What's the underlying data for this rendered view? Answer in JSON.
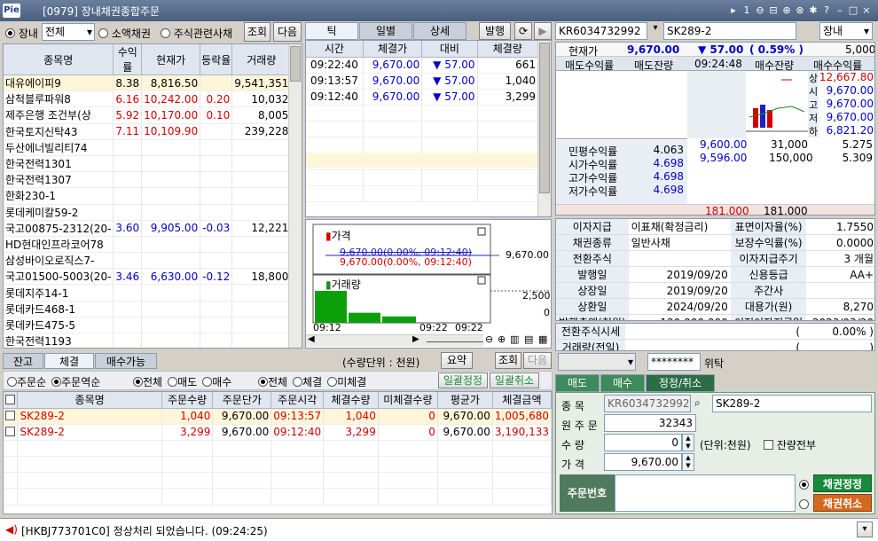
{
  "window": {
    "title": "[0979] 장내채권종합주문",
    "logo": "Pie",
    "controls": [
      "▸",
      "1",
      "⊖",
      "⊟",
      "⊕",
      "⊗",
      "✱",
      "?",
      "–",
      "□",
      "×"
    ]
  },
  "left": {
    "market_options": [
      {
        "label": "장내",
        "on": true
      },
      {
        "label": "소액채권",
        "on": false
      },
      {
        "label": "주식관련사채",
        "on": false
      }
    ],
    "filter_value": "전체",
    "btn_query": "조회",
    "btn_next": "다음",
    "headers": [
      "종목명",
      "수익률",
      "현재가",
      "등락율",
      "거래량"
    ],
    "rows": [
      {
        "name": "대유에이피9",
        "yield": "8.38",
        "price": "8,816.50",
        "chg": "",
        "vol": "9,541,351",
        "sel": true
      },
      {
        "name": "삼척블루파워8",
        "yield": "6.16",
        "price": "10,242.00",
        "chg": "0.20",
        "vol": "10,032",
        "color": "red"
      },
      {
        "name": "제주은행 조건부(상",
        "yield": "5.92",
        "price": "10,170.00",
        "chg": "0.10",
        "vol": "8,005",
        "color": "red"
      },
      {
        "name": "한국토지신탁43",
        "yield": "7.11",
        "price": "10,109.90",
        "chg": "",
        "vol": "239,228",
        "color": "red"
      },
      {
        "name": "두산에너빌리티74",
        "yield": "",
        "price": "",
        "chg": "",
        "vol": ""
      },
      {
        "name": "한국전력1301",
        "yield": "",
        "price": "",
        "chg": "",
        "vol": ""
      },
      {
        "name": "한국전력1307",
        "yield": "",
        "price": "",
        "chg": "",
        "vol": ""
      },
      {
        "name": "한화230-1",
        "yield": "",
        "price": "",
        "chg": "",
        "vol": ""
      },
      {
        "name": "롯데케미칼59-2",
        "yield": "",
        "price": "",
        "chg": "",
        "vol": ""
      },
      {
        "name": "국고00875-2312(20-",
        "yield": "3.60",
        "price": "9,905.00",
        "chg": "-0.03",
        "vol": "12,221",
        "color": "blue"
      },
      {
        "name": "HD현대인프라코어78",
        "yield": "",
        "price": "",
        "chg": "",
        "vol": ""
      },
      {
        "name": "삼성바이오로직스7-",
        "yield": "",
        "price": "",
        "chg": "",
        "vol": ""
      },
      {
        "name": "국고01500-5003(20-",
        "yield": "3.46",
        "price": "6,630.00",
        "chg": "-0.12",
        "vol": "18,800",
        "color": "blue"
      },
      {
        "name": "롯데지주14-1",
        "yield": "",
        "price": "",
        "chg": "",
        "vol": ""
      },
      {
        "name": "롯데카드468-1",
        "yield": "",
        "price": "",
        "chg": "",
        "vol": ""
      },
      {
        "name": "롯데카드475-5",
        "yield": "",
        "price": "",
        "chg": "",
        "vol": ""
      },
      {
        "name": "한국전력1193",
        "yield": "",
        "price": "",
        "chg": "",
        "vol": ""
      },
      {
        "name": "한국전력1269",
        "yield": "",
        "price": "",
        "chg": "",
        "vol": ""
      }
    ]
  },
  "tick": {
    "tabs": [
      "틱",
      "일별",
      "상세"
    ],
    "btn_issue": "발행",
    "headers": [
      "시간",
      "체결가",
      "대비",
      "체결량"
    ],
    "rows": [
      {
        "time": "09:22:40",
        "price": "9,670.00",
        "diff": "▼ 57.00",
        "qty": "661"
      },
      {
        "time": "09:13:57",
        "price": "9,670.00",
        "diff": "▼ 57.00",
        "qty": "1,040"
      },
      {
        "time": "09:12:40",
        "price": "9,670.00",
        "diff": "▼ 57.00",
        "qty": "3,299"
      }
    ]
  },
  "chart": {
    "label_price": "가격",
    "label_vol": "거래량",
    "legend1": "9,670.00(0.00%, 09:12:40)",
    "legend2": "9,670.00(0.00%, 09:12:40)",
    "price_tick": "9,670.00",
    "vol_ticks": [
      "2,500",
      "0"
    ],
    "x_ticks": [
      "09:12",
      "09:22",
      "09:22"
    ]
  },
  "chart_data": {
    "type": "bar",
    "categories": [
      "09:12",
      "09:13",
      "09:22"
    ],
    "values": [
      3299,
      1040,
      661
    ],
    "ylim": [
      0,
      5000
    ],
    "price_line": 9670
  },
  "quote": {
    "code": "KR6034732992",
    "name": "SK289-2",
    "market": "장내",
    "cur_label": "현재가",
    "cur_price": "9,670.00",
    "cur_diff": "▼ 57.00",
    "cur_pct": "( 0.59% )",
    "cur_vol": "5,000",
    "headers": [
      "매도수익률",
      "매도잔량",
      "09:24:48",
      "매수잔량",
      "매수수익률"
    ],
    "side_labels": [
      "상",
      "시",
      "고",
      "저",
      "하"
    ],
    "side_values": [
      "12,667.80",
      "9,670.00",
      "9,670.00",
      "9,670.00",
      "6,821.20"
    ],
    "bids": [
      {
        "price": "9,600.00",
        "qty": "31,000",
        "yield": "5.275"
      },
      {
        "price": "9,596.00",
        "qty": "150,000",
        "yield": "5.309"
      }
    ],
    "yields": [
      {
        "label": "민평수익률",
        "value": "4.063"
      },
      {
        "label": "시가수익률",
        "value": "4.698"
      },
      {
        "label": "고가수익률",
        "value": "4.698"
      },
      {
        "label": "저가수익률",
        "value": "4.698"
      }
    ],
    "total_ask": "181,000",
    "total_bid": "181,000"
  },
  "info": [
    [
      "이자지급",
      "이표채(확정금리)",
      "표면이자율(%)",
      "1.7550"
    ],
    [
      "채권종류",
      "일반사채",
      "보장수익률(%)",
      "0.0000"
    ],
    [
      "전환주식",
      "",
      "이자지급주기",
      "3 개월"
    ],
    [
      "발행일",
      "2019/09/20",
      "신용등급",
      "AA+"
    ],
    [
      "상장일",
      "2019/09/20",
      "주간사",
      ""
    ],
    [
      "상환일",
      "2024/09/20",
      "대용가(원)",
      "8,270"
    ],
    [
      "발행총액(천원)",
      "120,000,000",
      "이전이자지급일",
      "2023/03/20"
    ]
  ],
  "conv": [
    {
      "label": "전환주식시세",
      "v1": "(",
      "v2": "0.00% )"
    },
    {
      "label": "거래량(전일)",
      "v1": "(",
      "v2": ")"
    }
  ],
  "bottom": {
    "tabs": [
      "잔고",
      "체결",
      "매수가능"
    ],
    "unit": "(수량단위 : 천원)",
    "btn_sum": "요약",
    "btn_query": "조회",
    "btn_next": "다음",
    "sort_opts": [
      {
        "label": "주문순",
        "on": false
      },
      {
        "label": "주문역순",
        "on": true
      }
    ],
    "side_opts": [
      {
        "label": "전체",
        "on": true
      },
      {
        "label": "매도",
        "on": false
      },
      {
        "label": "매수",
        "on": false
      }
    ],
    "fill_opts": [
      {
        "label": "전체",
        "on": true
      },
      {
        "label": "체결",
        "on": false
      },
      {
        "label": "미체결",
        "on": false
      }
    ],
    "btn_bulk_mod": "일괄정정",
    "btn_bulk_cancel": "일괄취소",
    "headers": [
      "종목명",
      "주문수량",
      "주문단가",
      "주문시각",
      "체결수량",
      "미체결수량",
      "평균가",
      "체결금액"
    ],
    "rows": [
      {
        "name": "SK289-2",
        "qty": "1,040",
        "price": "9,670.00",
        "time": "09:13:57",
        "filled": "1,040",
        "open": "0",
        "avg": "9,670.00",
        "amt": "1,005,680",
        "sel": true
      },
      {
        "name": "SK289-2",
        "qty": "3,299",
        "price": "9,670.00",
        "time": "09:12:40",
        "filled": "3,299",
        "open": "0",
        "avg": "9,670.00",
        "amt": "3,190,133"
      }
    ]
  },
  "order": {
    "password": "********",
    "trust_label": "위탁",
    "tabs": [
      "매도",
      "매수",
      "정정/취소"
    ],
    "label_code": "종  목",
    "code": "KR6034732992",
    "name": "SK289-2",
    "label_orig": "원 주 문",
    "orig": "32343",
    "label_qty": "수   량",
    "qty": "0",
    "unit": "(단위:천원)",
    "chk_all": "잔량전부",
    "label_price": "가   격",
    "price": "9,670.00",
    "label_orderno": "주문번호",
    "btn_modify": "채권정정",
    "btn_cancel": "채권취소"
  },
  "status": {
    "message": "[HKBJ773701C0] 정상처리 되었습니다. (09:24:25)"
  },
  "colors": {
    "accent": "#1a8a3a",
    "highlight": "#fff6d9",
    "title": "#4a5e7e"
  }
}
